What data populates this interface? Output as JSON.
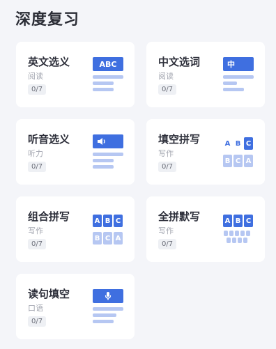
{
  "page": {
    "title": "深度复习"
  },
  "colors": {
    "accent": "#3f6fe0",
    "accent_light": "#b6c7f2",
    "background": "#f4f5f9"
  },
  "cards": [
    {
      "title": "英文选义",
      "subtitle": "阅读",
      "progress": "0/7",
      "icon_text": "ABC",
      "icon": "abc-card-icon"
    },
    {
      "title": "中文选词",
      "subtitle": "阅读",
      "progress": "0/7",
      "icon_text": "中",
      "icon": "chinese-card-icon"
    },
    {
      "title": "听音选义",
      "subtitle": "听力",
      "progress": "0/7",
      "icon": "speaker-card-icon"
    },
    {
      "title": "填空拼写",
      "subtitle": "写作",
      "progress": "0/7",
      "letters": [
        "A",
        "B",
        "C"
      ],
      "icon": "fill-spelling-icon"
    },
    {
      "title": "组合拼写",
      "subtitle": "写作",
      "progress": "0/7",
      "letters": [
        "A",
        "B",
        "C"
      ],
      "icon": "combine-spelling-icon"
    },
    {
      "title": "全拼默写",
      "subtitle": "写作",
      "progress": "0/7",
      "letters": [
        "A",
        "B",
        "C"
      ],
      "icon": "keyboard-spelling-icon"
    },
    {
      "title": "读句填空",
      "subtitle": "口语",
      "progress": "0/7",
      "icon": "microphone-card-icon"
    }
  ]
}
